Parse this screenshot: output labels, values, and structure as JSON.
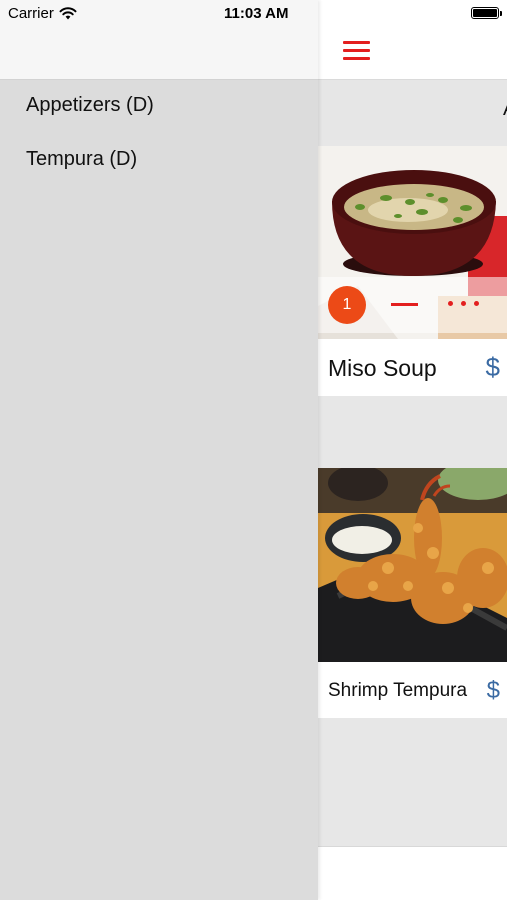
{
  "status_bar": {
    "carrier": "Carrier",
    "time": "11:03 AM",
    "wifi_icon": "wifi-icon",
    "battery_icon": "battery-icon"
  },
  "drawer": {
    "items": [
      {
        "label": "Appetizers (D)"
      },
      {
        "label": "Tempura (D)"
      }
    ]
  },
  "header": {
    "menu_icon": "hamburger-menu-icon",
    "accent_color": "#e31f1f"
  },
  "category": {
    "title": "A"
  },
  "menu_items": [
    {
      "name": "Miso Soup",
      "price_symbol": "$",
      "quantity": "1",
      "photo": "miso-soup-photo"
    },
    {
      "name": "Shrimp Tempura",
      "price_symbol": "$",
      "photo": "shrimp-tempura-photo"
    }
  ],
  "colors": {
    "badge": "#ec4a17",
    "price": "#3a6aa3",
    "drawer_bg": "#dcdcdc"
  }
}
